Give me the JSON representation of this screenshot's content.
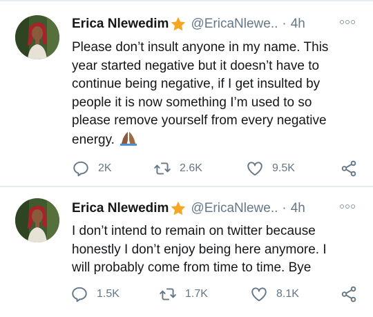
{
  "tweets": [
    {
      "author_name": "Erica Nlewedim",
      "handle": "@EricaNlewe..",
      "separator": "·",
      "time": "4h",
      "text_lines": [
        "Please don’t insult anyone in my name. This",
        "year started negative but it doesn’t have to",
        "continue being negative, if I get insulted by",
        "people it is now something I’m used to so",
        "please remove yourself from every negative",
        "energy."
      ],
      "emoji": "folded-hands-emoji",
      "replies": "2K",
      "retweets": "2.6K",
      "likes": "9.5K"
    },
    {
      "author_name": "Erica Nlewedim",
      "handle": "@EricaNlewe..",
      "separator": "·",
      "time": "4h",
      "text_lines": [
        "I don’t intend to remain on twitter because",
        "honestly I don’t enjoy being here anymore. I",
        "will probably come from time to time. Bye"
      ],
      "replies": "1.5K",
      "retweets": "1.7K",
      "likes": "8.1K"
    }
  ],
  "icons": {
    "verified_badge": "star-icon",
    "more": "more-options-icon",
    "reply": "reply-icon",
    "retweet": "retweet-icon",
    "like": "heart-icon",
    "share": "share-icon"
  },
  "colors": {
    "text": "#14171a",
    "muted": "#657786",
    "star": "#f5a623",
    "divider": "#e6ecf0"
  }
}
